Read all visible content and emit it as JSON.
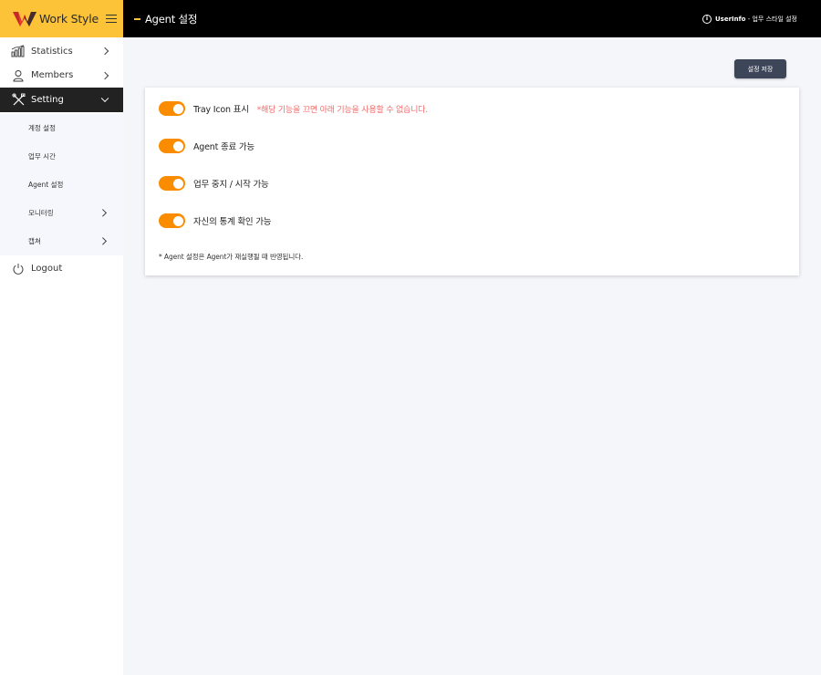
{
  "sidebar": {
    "brand": "Work Style",
    "items": [
      {
        "label": "Statistics"
      },
      {
        "label": "Members"
      },
      {
        "label": "Setting"
      }
    ],
    "submenu": [
      {
        "label": "계정 설정"
      },
      {
        "label": "업무 시간"
      },
      {
        "label": "Agent 설정"
      },
      {
        "label": "모니터링"
      },
      {
        "label": "캡쳐"
      }
    ],
    "logout": "Logout"
  },
  "topbar": {
    "title": "Agent 설정",
    "userinfo_label": "UserInfo",
    "userinfo_sep": " - ",
    "userinfo_value": "업무 스타일 설정"
  },
  "main": {
    "save_label": "설정 저장",
    "settings": [
      {
        "label": "Tray Icon 표시",
        "enabled": true,
        "warning": "*해당 기능을 끄면 아래 기능을 사용할 수 없습니다."
      },
      {
        "label": "Agent 종료 가능",
        "enabled": true
      },
      {
        "label": "업무 중지 / 시작 가능",
        "enabled": true
      },
      {
        "label": "자신의 통계 확인 가능",
        "enabled": true
      }
    ],
    "note": "* Agent 설정은 Agent가 재실행될 때 반영됩니다."
  },
  "colors": {
    "brand_yellow": "#fcc238",
    "toggle_on": "#fb8c00",
    "warning": "#f26a6a",
    "button": "#3d4658"
  }
}
